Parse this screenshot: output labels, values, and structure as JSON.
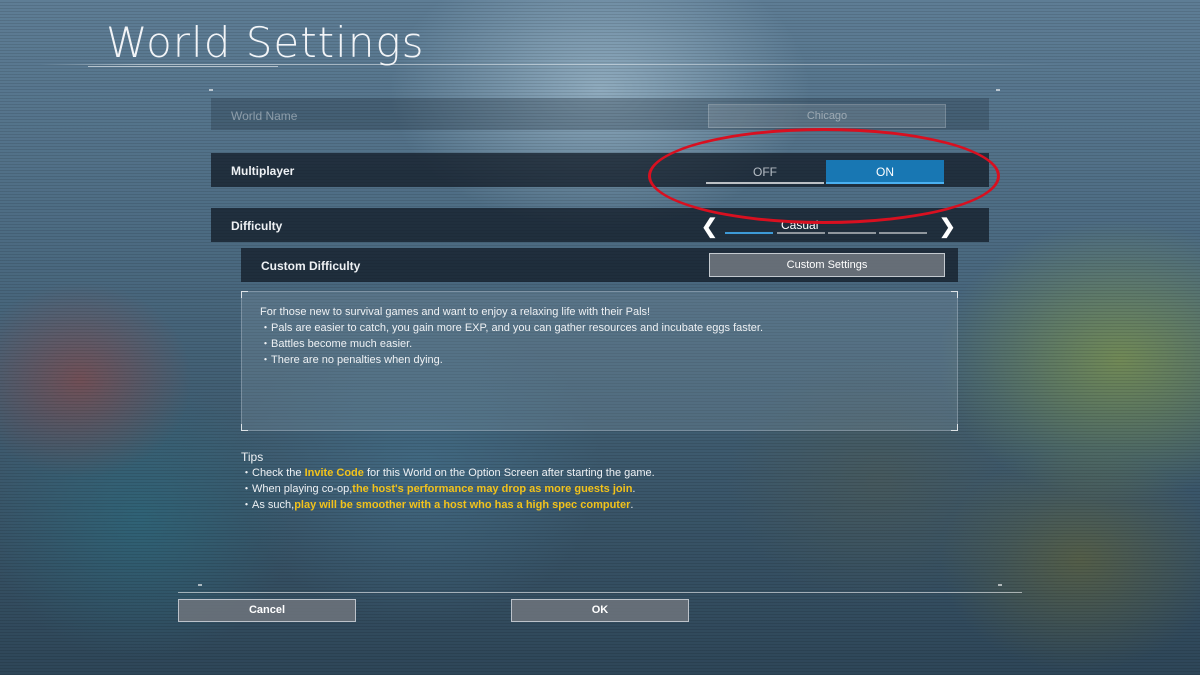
{
  "title": "World Settings",
  "world_name": {
    "label": "World Name",
    "value": "Chicago"
  },
  "multiplayer": {
    "label": "Multiplayer",
    "off": "OFF",
    "on": "ON",
    "selected": "ON"
  },
  "difficulty": {
    "label": "Difficulty",
    "value": "Casual",
    "left_icon": "chevron-left-icon",
    "right_icon": "chevron-right-icon"
  },
  "custom_difficulty": {
    "label": "Custom Difficulty",
    "button": "Custom Settings"
  },
  "description": {
    "intro": "For those new to survival games and want to enjoy a relaxing life with their Pals!",
    "bullets": [
      "・Pals are easier to catch, you gain more EXP, and you can gather resources and incubate eggs faster.",
      "・Battles become much easier.",
      "・There are no penalties when dying."
    ]
  },
  "tips": {
    "heading": "Tips",
    "line1": {
      "a": "・Check the ",
      "hl": "Invite Code",
      "b": " for this World on the Option Screen after starting the game."
    },
    "line2": {
      "a": "・When playing co-op,",
      "hl": "the host's performance may drop as more guests join",
      "b": "."
    },
    "line3": {
      "a": "・As such,",
      "hl": "play will be smoother with a host who has a high spec computer",
      "b": "."
    }
  },
  "buttons": {
    "cancel": "Cancel",
    "ok": "OK"
  },
  "colors": {
    "accent": "#1877b3",
    "highlight": "#f2c21b",
    "annotation": "#d81020"
  }
}
